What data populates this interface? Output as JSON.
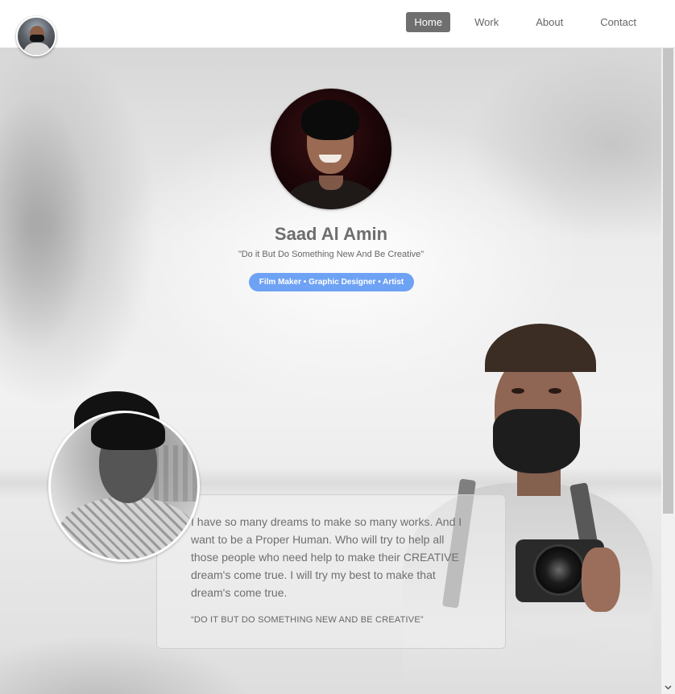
{
  "nav": {
    "items": [
      {
        "label": "Home",
        "active": true
      },
      {
        "label": "Work",
        "active": false
      },
      {
        "label": "About",
        "active": false
      },
      {
        "label": "Contact",
        "active": false
      }
    ]
  },
  "hero": {
    "name": "Saad Al Amin",
    "quote": "\"Do it But Do Something New And Be Creative\"",
    "roles": "Film Maker • Graphic Designer • Artist"
  },
  "about": {
    "text": "I have so many dreams to make so many works. And I want to be a Proper Human. Who will try to help all those people who need help to make their CREATIVE dream's come true. I will try my best to make that dream's come true.",
    "quote": "“DO IT BUT DO SOMETHING NEW AND BE CREATIVE”"
  },
  "colors": {
    "accent": "#6ea2f4",
    "nav_active": "#6f6f6f",
    "text": "#6f6f6f"
  },
  "icons": {
    "scroll_down": "chevron-down-icon"
  }
}
